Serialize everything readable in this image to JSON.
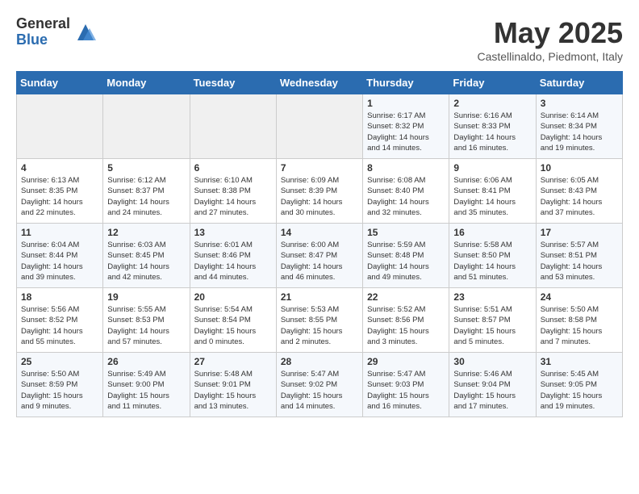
{
  "header": {
    "logo_general": "General",
    "logo_blue": "Blue",
    "month_title": "May 2025",
    "location": "Castellinaldo, Piedmont, Italy"
  },
  "calendar": {
    "days_of_week": [
      "Sunday",
      "Monday",
      "Tuesday",
      "Wednesday",
      "Thursday",
      "Friday",
      "Saturday"
    ],
    "weeks": [
      [
        {
          "day": "",
          "info": ""
        },
        {
          "day": "",
          "info": ""
        },
        {
          "day": "",
          "info": ""
        },
        {
          "day": "",
          "info": ""
        },
        {
          "day": "1",
          "info": "Sunrise: 6:17 AM\nSunset: 8:32 PM\nDaylight: 14 hours\nand 14 minutes."
        },
        {
          "day": "2",
          "info": "Sunrise: 6:16 AM\nSunset: 8:33 PM\nDaylight: 14 hours\nand 16 minutes."
        },
        {
          "day": "3",
          "info": "Sunrise: 6:14 AM\nSunset: 8:34 PM\nDaylight: 14 hours\nand 19 minutes."
        }
      ],
      [
        {
          "day": "4",
          "info": "Sunrise: 6:13 AM\nSunset: 8:35 PM\nDaylight: 14 hours\nand 22 minutes."
        },
        {
          "day": "5",
          "info": "Sunrise: 6:12 AM\nSunset: 8:37 PM\nDaylight: 14 hours\nand 24 minutes."
        },
        {
          "day": "6",
          "info": "Sunrise: 6:10 AM\nSunset: 8:38 PM\nDaylight: 14 hours\nand 27 minutes."
        },
        {
          "day": "7",
          "info": "Sunrise: 6:09 AM\nSunset: 8:39 PM\nDaylight: 14 hours\nand 30 minutes."
        },
        {
          "day": "8",
          "info": "Sunrise: 6:08 AM\nSunset: 8:40 PM\nDaylight: 14 hours\nand 32 minutes."
        },
        {
          "day": "9",
          "info": "Sunrise: 6:06 AM\nSunset: 8:41 PM\nDaylight: 14 hours\nand 35 minutes."
        },
        {
          "day": "10",
          "info": "Sunrise: 6:05 AM\nSunset: 8:43 PM\nDaylight: 14 hours\nand 37 minutes."
        }
      ],
      [
        {
          "day": "11",
          "info": "Sunrise: 6:04 AM\nSunset: 8:44 PM\nDaylight: 14 hours\nand 39 minutes."
        },
        {
          "day": "12",
          "info": "Sunrise: 6:03 AM\nSunset: 8:45 PM\nDaylight: 14 hours\nand 42 minutes."
        },
        {
          "day": "13",
          "info": "Sunrise: 6:01 AM\nSunset: 8:46 PM\nDaylight: 14 hours\nand 44 minutes."
        },
        {
          "day": "14",
          "info": "Sunrise: 6:00 AM\nSunset: 8:47 PM\nDaylight: 14 hours\nand 46 minutes."
        },
        {
          "day": "15",
          "info": "Sunrise: 5:59 AM\nSunset: 8:48 PM\nDaylight: 14 hours\nand 49 minutes."
        },
        {
          "day": "16",
          "info": "Sunrise: 5:58 AM\nSunset: 8:50 PM\nDaylight: 14 hours\nand 51 minutes."
        },
        {
          "day": "17",
          "info": "Sunrise: 5:57 AM\nSunset: 8:51 PM\nDaylight: 14 hours\nand 53 minutes."
        }
      ],
      [
        {
          "day": "18",
          "info": "Sunrise: 5:56 AM\nSunset: 8:52 PM\nDaylight: 14 hours\nand 55 minutes."
        },
        {
          "day": "19",
          "info": "Sunrise: 5:55 AM\nSunset: 8:53 PM\nDaylight: 14 hours\nand 57 minutes."
        },
        {
          "day": "20",
          "info": "Sunrise: 5:54 AM\nSunset: 8:54 PM\nDaylight: 15 hours\nand 0 minutes."
        },
        {
          "day": "21",
          "info": "Sunrise: 5:53 AM\nSunset: 8:55 PM\nDaylight: 15 hours\nand 2 minutes."
        },
        {
          "day": "22",
          "info": "Sunrise: 5:52 AM\nSunset: 8:56 PM\nDaylight: 15 hours\nand 3 minutes."
        },
        {
          "day": "23",
          "info": "Sunrise: 5:51 AM\nSunset: 8:57 PM\nDaylight: 15 hours\nand 5 minutes."
        },
        {
          "day": "24",
          "info": "Sunrise: 5:50 AM\nSunset: 8:58 PM\nDaylight: 15 hours\nand 7 minutes."
        }
      ],
      [
        {
          "day": "25",
          "info": "Sunrise: 5:50 AM\nSunset: 8:59 PM\nDaylight: 15 hours\nand 9 minutes."
        },
        {
          "day": "26",
          "info": "Sunrise: 5:49 AM\nSunset: 9:00 PM\nDaylight: 15 hours\nand 11 minutes."
        },
        {
          "day": "27",
          "info": "Sunrise: 5:48 AM\nSunset: 9:01 PM\nDaylight: 15 hours\nand 13 minutes."
        },
        {
          "day": "28",
          "info": "Sunrise: 5:47 AM\nSunset: 9:02 PM\nDaylight: 15 hours\nand 14 minutes."
        },
        {
          "day": "29",
          "info": "Sunrise: 5:47 AM\nSunset: 9:03 PM\nDaylight: 15 hours\nand 16 minutes."
        },
        {
          "day": "30",
          "info": "Sunrise: 5:46 AM\nSunset: 9:04 PM\nDaylight: 15 hours\nand 17 minutes."
        },
        {
          "day": "31",
          "info": "Sunrise: 5:45 AM\nSunset: 9:05 PM\nDaylight: 15 hours\nand 19 minutes."
        }
      ]
    ]
  }
}
